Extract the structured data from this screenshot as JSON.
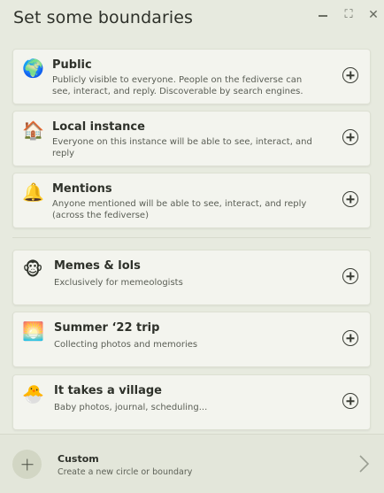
{
  "header": {
    "title": "Set some boundaries",
    "controls": [
      "minimize-icon",
      "maximize-icon",
      "close-icon"
    ],
    "close_glyph": "✕",
    "maximize_glyph": "⛶"
  },
  "boundaries": [
    {
      "icon": "globe-icon",
      "emoji": "🌍",
      "title": "Public",
      "description": "Publicly visible to everyone. People on the fediverse can see, interact, and reply. Discoverable by search engines."
    },
    {
      "icon": "house-icon",
      "emoji": "🏠",
      "title": "Local instance",
      "description": "Everyone on this instance will be able to see, interact, and reply"
    },
    {
      "icon": "bell-icon",
      "emoji": "🔔",
      "title": "Mentions",
      "description": "Anyone mentioned will be able to see, interact, and reply (across the fediverse)"
    }
  ],
  "circles": [
    {
      "icon": "monkey-icon",
      "emoji": "🐵",
      "title": "Memes & lols",
      "description": "Exclusively for memeologists"
    },
    {
      "icon": "sunset-icon",
      "emoji": "🌅",
      "title": "Summer ‘22 trip",
      "description": "Collecting photos and memories"
    },
    {
      "icon": "hatching-chick-icon",
      "emoji": "🐣",
      "title": "It takes a village",
      "description": "Baby photos, journal, scheduling..."
    }
  ],
  "footer": {
    "title": "Custom",
    "description": "Create a new circle or boundary"
  },
  "colors": {
    "background": "#e7eadf",
    "card": "#f3f4ee",
    "text": "#2e312a"
  }
}
